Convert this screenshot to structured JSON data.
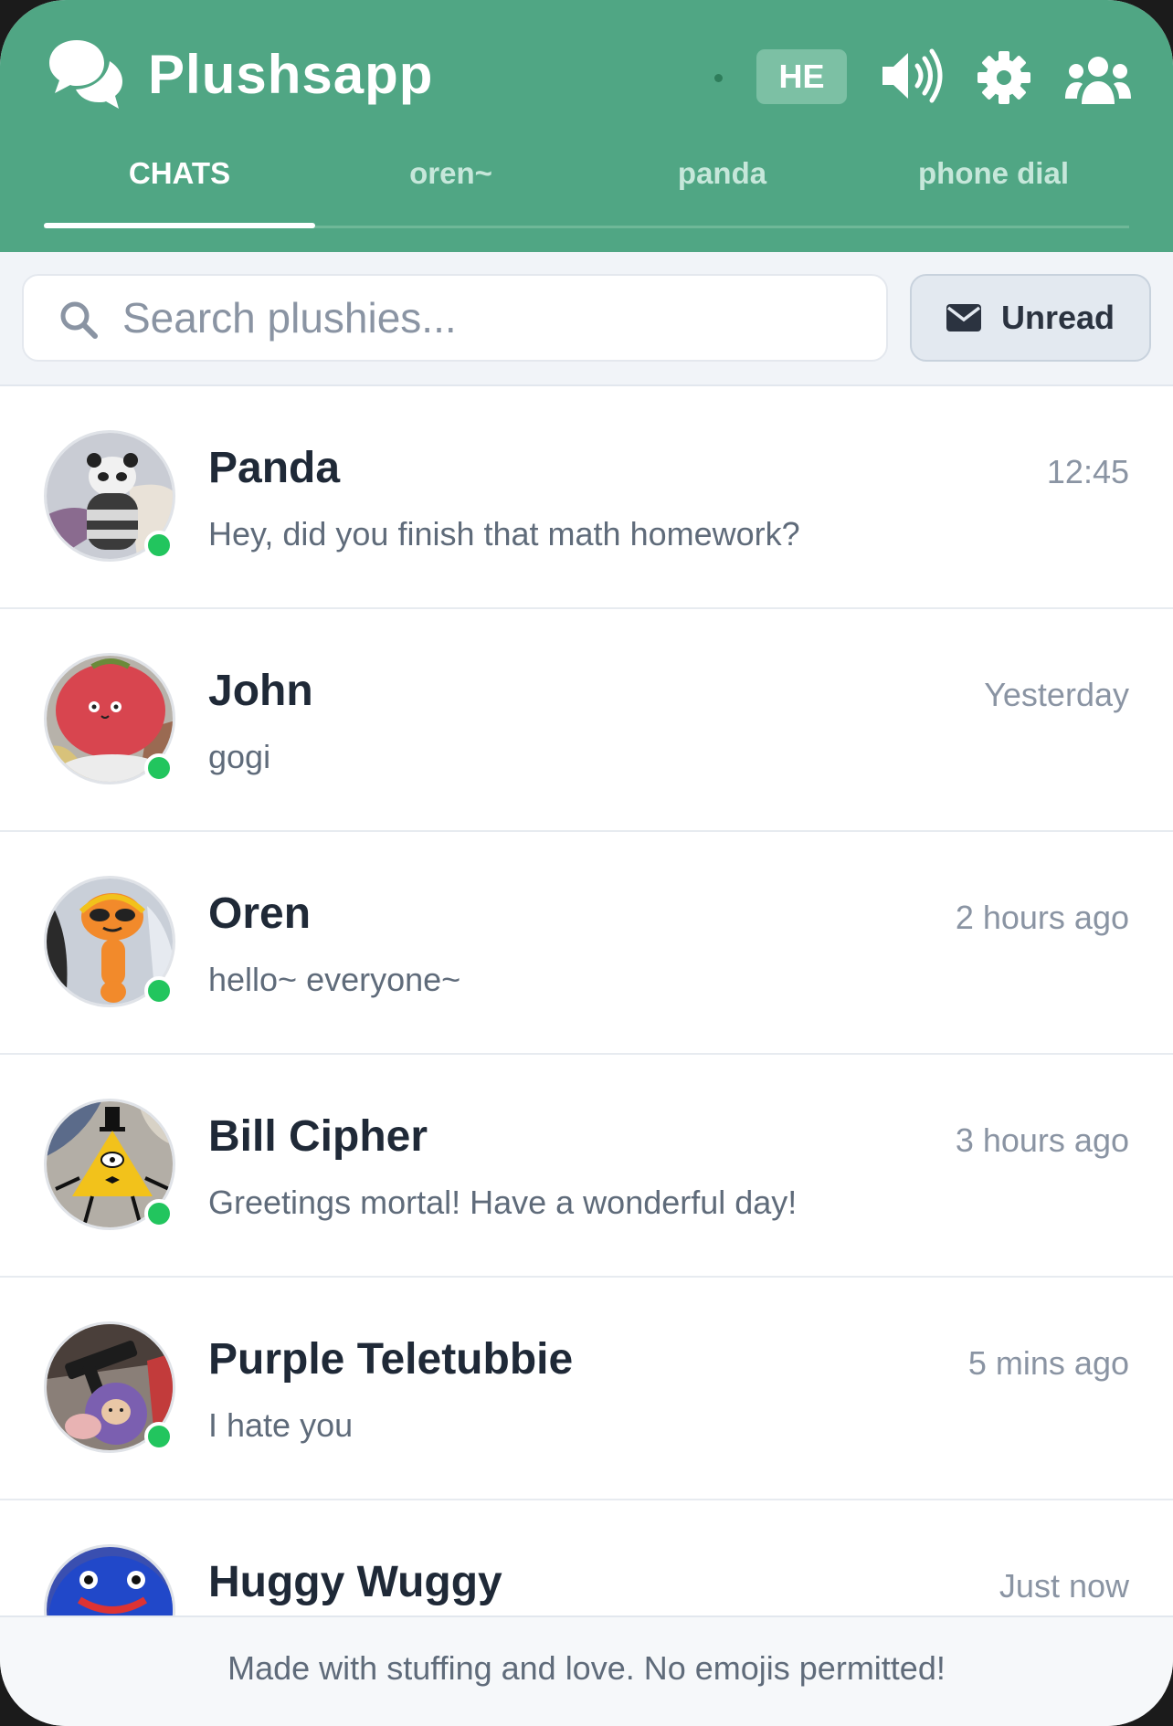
{
  "app": {
    "title": "Plushsapp"
  },
  "header": {
    "language_label": "HE",
    "icons": [
      "chat-bubbles-icon",
      "speaker-icon",
      "gear-icon",
      "users-icon"
    ]
  },
  "tabs": [
    {
      "label": "CHATS",
      "active": true
    },
    {
      "label": "oren~",
      "active": false
    },
    {
      "label": "panda",
      "active": false
    },
    {
      "label": "phone dial",
      "active": false
    }
  ],
  "search": {
    "placeholder": "Search plushies...",
    "value": ""
  },
  "filter": {
    "unread_label": "Unread"
  },
  "chats": [
    {
      "name": "Panda",
      "time": "12:45",
      "message": "Hey, did you finish that math homework?",
      "online": true
    },
    {
      "name": "John",
      "time": "Yesterday",
      "message": "gogi",
      "online": true
    },
    {
      "name": "Oren",
      "time": "2 hours ago",
      "message": "hello~ everyone~",
      "online": true
    },
    {
      "name": "Bill Cipher",
      "time": "3 hours ago",
      "message": "Greetings mortal! Have a wonderful day!",
      "online": true
    },
    {
      "name": "Purple Teletubbie",
      "time": "5 mins ago",
      "message": "I hate you",
      "online": true
    },
    {
      "name": "Huggy Wuggy",
      "time": "Just now",
      "message": "",
      "online": false
    }
  ],
  "footer": {
    "text": "Made with stuffing and love. No emojis permitted!"
  },
  "colors": {
    "brand": "#50a684",
    "online": "#22c55e"
  }
}
